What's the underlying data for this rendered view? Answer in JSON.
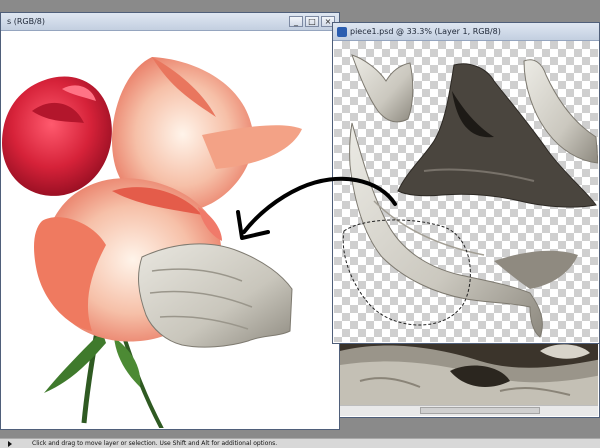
{
  "window_left": {
    "title": "s (RGB/8)"
  },
  "window_right": {
    "title": "piece1.psd @ 33.3% (Layer 1, RGB/8)"
  },
  "window_controls": {
    "minimize": "_",
    "maximize": "□",
    "close": "×"
  },
  "status_bar": {
    "message": "Click and drag to move layer or selection.  Use Shift and Alt for additional options."
  },
  "icons": [
    "psd-file-icon",
    "minimize-icon",
    "maximize-icon",
    "close-icon",
    "status-arrow-icon"
  ],
  "colors": {
    "workspace": "#8a8a8a",
    "titlebar": "#c9d5e6",
    "rose_red": "#d9263e",
    "rose_peach": "#f08870",
    "wood": "#d2d0c8"
  }
}
